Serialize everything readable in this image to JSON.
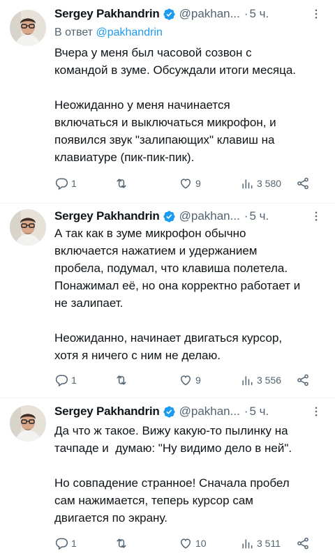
{
  "tweets": [
    {
      "author": {
        "name": "Sergey Pakhandrin",
        "handle": "@pakhan...",
        "time": "5 ч."
      },
      "reply_prefix": "В ответ ",
      "reply_mention": "@pakhandrin",
      "text": "Вчера у меня был часовой созвон с\nкомандой в зуме. Обсуждали итоги месяца.\n\nНеожиданно у меня начинается\nвключаться и выключаться микрофон, и\nпоявился звук \"залипающих\" клавиш на\nклавиатуре (пик-пик-пик).",
      "stats": {
        "replies": "1",
        "retweets": "",
        "likes": "9",
        "views": "3 580"
      }
    },
    {
      "author": {
        "name": "Sergey Pakhandrin",
        "handle": "@pakhan...",
        "time": "5 ч."
      },
      "text": "А так как в зуме микрофон обычно\nвключается нажатием и удержанием\nпробела, подумал, что клавиша полетела.\nПонажимал её, но она корректно работает и\nне залипает.\n\nНеожиданно, начинает двигаться курсор,\nхотя я ничего с ним не делаю.",
      "stats": {
        "replies": "1",
        "retweets": "",
        "likes": "9",
        "views": "3 556"
      }
    },
    {
      "author": {
        "name": "Sergey Pakhandrin",
        "handle": "@pakhan...",
        "time": "5 ч."
      },
      "text": "Да что ж такое. Вижу какую-то пылинку на\nтачпаде и  думаю: \"Ну видимо дело в ней\".\n\nНо совпадение странное! Сначала пробел\nсам нажимается, теперь курсор сам\nдвигается по экрану.",
      "stats": {
        "replies": "1",
        "retweets": "",
        "likes": "10",
        "views": "3 511"
      }
    }
  ],
  "colors": {
    "text": "#0f1419",
    "secondary": "#536471",
    "accent": "#1d9bf0",
    "divider": "#eff3f4"
  },
  "icons": [
    "verified-icon",
    "more-icon",
    "reply-icon",
    "retweet-icon",
    "like-icon",
    "views-icon",
    "share-icon"
  ]
}
